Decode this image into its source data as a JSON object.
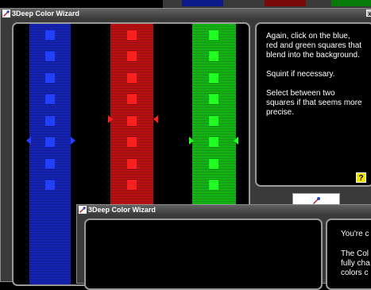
{
  "colors": {
    "titlebar": "#4a4a4a",
    "blue": "#2240ff",
    "red": "#ff2020",
    "green": "#22ff22",
    "help": "#f2e400"
  },
  "window1": {
    "title": "3Deep Color Wizard",
    "close_glyph": "x",
    "instructions": [
      "Again, click on the blue, red and green squares that blend into the background.",
      "Squint if necessary.",
      "Select between two squares if that seems more precise."
    ],
    "help_label": "?"
  },
  "window2": {
    "title": "3Deep Color Wizard",
    "text_lines": [
      "You're c",
      "The Col",
      "fully cha",
      "colors c"
    ]
  }
}
